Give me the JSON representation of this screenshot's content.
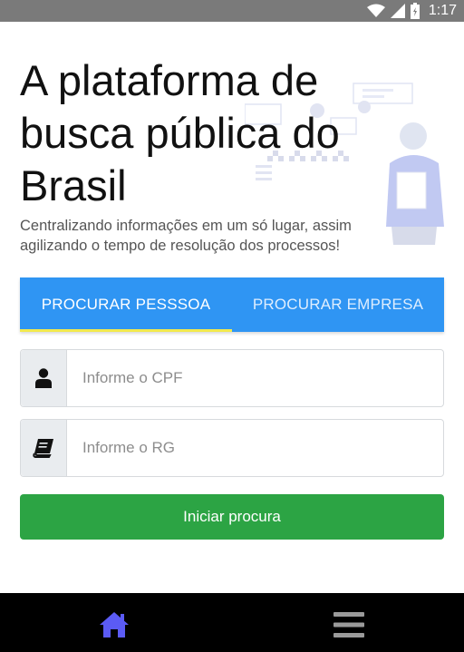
{
  "status_bar": {
    "time": "1:17",
    "icons": [
      "wifi-icon",
      "signal-icon",
      "battery-icon"
    ]
  },
  "hero": {
    "title": "A plataforma de busca pública do Brasil",
    "subtitle": "Centralizando informações em um só lugar, assim agilizando o tempo de resolução dos processos!"
  },
  "tabs": [
    {
      "label": "PROCURAR PESSSOA",
      "active": true
    },
    {
      "label": "PROCURAR EMPRESA",
      "active": false
    }
  ],
  "form": {
    "cpf": {
      "placeholder": "Informe o CPF",
      "icon": "user-icon",
      "value": ""
    },
    "rg": {
      "placeholder": "Informe o RG",
      "icon": "book-icon",
      "value": ""
    },
    "submit_label": "Iniciar procura"
  },
  "bottom_nav": {
    "items": [
      "home-icon",
      "menu-icon"
    ],
    "active_color": "#5b5bf5",
    "inactive_color": "#9a9a9a"
  },
  "colors": {
    "tab_bar": "#2f95f3",
    "tab_indicator": "#f2e94e",
    "submit": "#2ca444"
  }
}
